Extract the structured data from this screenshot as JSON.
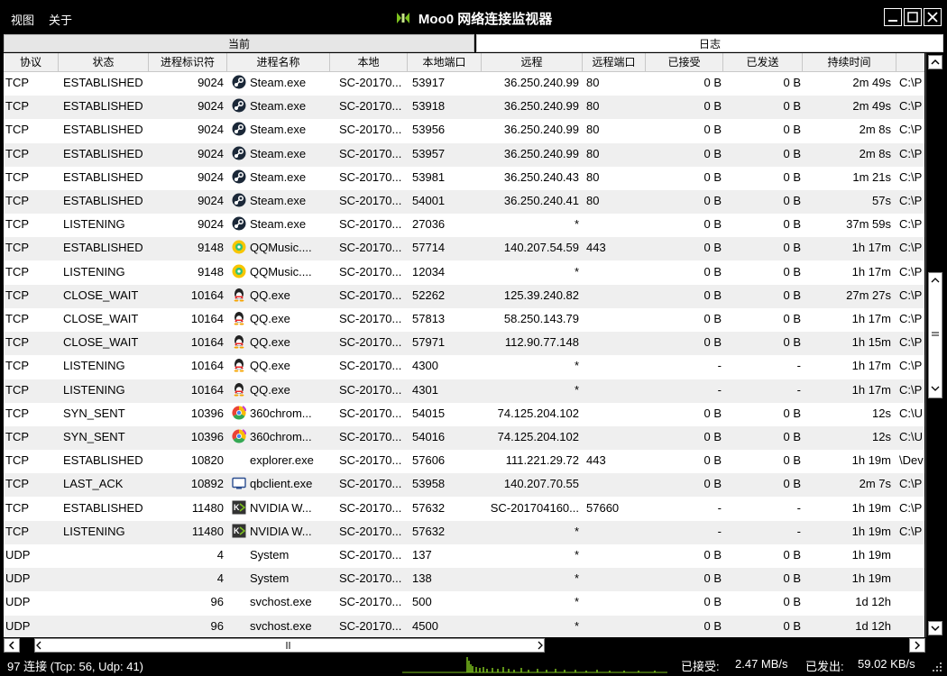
{
  "menu": {
    "view": "视图",
    "about": "关于"
  },
  "window": {
    "title": "Moo0 网络连接监视器"
  },
  "groups": {
    "current": "当前",
    "log": "日志"
  },
  "columns": {
    "protocol": "协议",
    "state": "状态",
    "pid": "进程标识符",
    "process": "进程名称",
    "local": "本地",
    "local_port": "本地端口",
    "remote": "远程",
    "remote_port": "远程端口",
    "received": "已接受",
    "sent": "已发送",
    "duration": "持续时间"
  },
  "rows": [
    {
      "protocol": "TCP",
      "state": "ESTABLISHED",
      "pid": "9024",
      "icon": "steam-icon",
      "process": "Steam.exe",
      "local": "SC-20170...",
      "local_port": "53917",
      "remote": "36.250.240.99",
      "remote_port": "80",
      "received": "0 B",
      "sent": "0 B",
      "duration": "2m 49s",
      "path": "C:\\P"
    },
    {
      "protocol": "TCP",
      "state": "ESTABLISHED",
      "pid": "9024",
      "icon": "steam-icon",
      "process": "Steam.exe",
      "local": "SC-20170...",
      "local_port": "53918",
      "remote": "36.250.240.99",
      "remote_port": "80",
      "received": "0 B",
      "sent": "0 B",
      "duration": "2m 49s",
      "path": "C:\\P"
    },
    {
      "protocol": "TCP",
      "state": "ESTABLISHED",
      "pid": "9024",
      "icon": "steam-icon",
      "process": "Steam.exe",
      "local": "SC-20170...",
      "local_port": "53956",
      "remote": "36.250.240.99",
      "remote_port": "80",
      "received": "0 B",
      "sent": "0 B",
      "duration": "2m 8s",
      "path": "C:\\P"
    },
    {
      "protocol": "TCP",
      "state": "ESTABLISHED",
      "pid": "9024",
      "icon": "steam-icon",
      "process": "Steam.exe",
      "local": "SC-20170...",
      "local_port": "53957",
      "remote": "36.250.240.99",
      "remote_port": "80",
      "received": "0 B",
      "sent": "0 B",
      "duration": "2m 8s",
      "path": "C:\\P"
    },
    {
      "protocol": "TCP",
      "state": "ESTABLISHED",
      "pid": "9024",
      "icon": "steam-icon",
      "process": "Steam.exe",
      "local": "SC-20170...",
      "local_port": "53981",
      "remote": "36.250.240.43",
      "remote_port": "80",
      "received": "0 B",
      "sent": "0 B",
      "duration": "1m 21s",
      "path": "C:\\P"
    },
    {
      "protocol": "TCP",
      "state": "ESTABLISHED",
      "pid": "9024",
      "icon": "steam-icon",
      "process": "Steam.exe",
      "local": "SC-20170...",
      "local_port": "54001",
      "remote": "36.250.240.41",
      "remote_port": "80",
      "received": "0 B",
      "sent": "0 B",
      "duration": "57s",
      "path": "C:\\P"
    },
    {
      "protocol": "TCP",
      "state": "LISTENING",
      "pid": "9024",
      "icon": "steam-icon",
      "process": "Steam.exe",
      "local": "SC-20170...",
      "local_port": "27036",
      "remote": "*",
      "remote_port": "",
      "received": "0 B",
      "sent": "0 B",
      "duration": "37m 59s",
      "path": "C:\\P"
    },
    {
      "protocol": "TCP",
      "state": "ESTABLISHED",
      "pid": "9148",
      "icon": "qqmusic-icon",
      "process": "QQMusic....",
      "local": "SC-20170...",
      "local_port": "57714",
      "remote": "140.207.54.59",
      "remote_port": "443",
      "received": "0 B",
      "sent": "0 B",
      "duration": "1h 17m",
      "path": "C:\\P"
    },
    {
      "protocol": "TCP",
      "state": "LISTENING",
      "pid": "9148",
      "icon": "qqmusic-icon",
      "process": "QQMusic....",
      "local": "SC-20170...",
      "local_port": "12034",
      "remote": "*",
      "remote_port": "",
      "received": "0 B",
      "sent": "0 B",
      "duration": "1h 17m",
      "path": "C:\\P"
    },
    {
      "protocol": "TCP",
      "state": "CLOSE_WAIT",
      "pid": "10164",
      "icon": "qq-icon",
      "process": "QQ.exe",
      "local": "SC-20170...",
      "local_port": "52262",
      "remote": "125.39.240.82",
      "remote_port": "",
      "received": "0 B",
      "sent": "0 B",
      "duration": "27m 27s",
      "path": "C:\\P"
    },
    {
      "protocol": "TCP",
      "state": "CLOSE_WAIT",
      "pid": "10164",
      "icon": "qq-icon",
      "process": "QQ.exe",
      "local": "SC-20170...",
      "local_port": "57813",
      "remote": "58.250.143.79",
      "remote_port": "",
      "received": "0 B",
      "sent": "0 B",
      "duration": "1h 17m",
      "path": "C:\\P"
    },
    {
      "protocol": "TCP",
      "state": "CLOSE_WAIT",
      "pid": "10164",
      "icon": "qq-icon",
      "process": "QQ.exe",
      "local": "SC-20170...",
      "local_port": "57971",
      "remote": "112.90.77.148",
      "remote_port": "",
      "received": "0 B",
      "sent": "0 B",
      "duration": "1h 15m",
      "path": "C:\\P"
    },
    {
      "protocol": "TCP",
      "state": "LISTENING",
      "pid": "10164",
      "icon": "qq-icon",
      "process": "QQ.exe",
      "local": "SC-20170...",
      "local_port": "4300",
      "remote": "*",
      "remote_port": "",
      "received": "-",
      "sent": "-",
      "duration": "1h 17m",
      "path": "C:\\P"
    },
    {
      "protocol": "TCP",
      "state": "LISTENING",
      "pid": "10164",
      "icon": "qq-icon",
      "process": "QQ.exe",
      "local": "SC-20170...",
      "local_port": "4301",
      "remote": "*",
      "remote_port": "",
      "received": "-",
      "sent": "-",
      "duration": "1h 17m",
      "path": "C:\\P"
    },
    {
      "protocol": "TCP",
      "state": "SYN_SENT",
      "pid": "10396",
      "icon": "360chrome-icon",
      "process": "360chrom...",
      "local": "SC-20170...",
      "local_port": "54015",
      "remote": "74.125.204.102",
      "remote_port": "",
      "received": "0 B",
      "sent": "0 B",
      "duration": "12s",
      "path": "C:\\U"
    },
    {
      "protocol": "TCP",
      "state": "SYN_SENT",
      "pid": "10396",
      "icon": "360chrome-icon",
      "process": "360chrom...",
      "local": "SC-20170...",
      "local_port": "54016",
      "remote": "74.125.204.102",
      "remote_port": "",
      "received": "0 B",
      "sent": "0 B",
      "duration": "12s",
      "path": "C:\\U"
    },
    {
      "protocol": "TCP",
      "state": "ESTABLISHED",
      "pid": "10820",
      "icon": "",
      "process": "explorer.exe",
      "local": "SC-20170...",
      "local_port": "57606",
      "remote": "111.221.29.72",
      "remote_port": "443",
      "received": "0 B",
      "sent": "0 B",
      "duration": "1h 19m",
      "path": "\\Dev"
    },
    {
      "protocol": "TCP",
      "state": "LAST_ACK",
      "pid": "10892",
      "icon": "qbclient-icon",
      "process": "qbclient.exe",
      "local": "SC-20170...",
      "local_port": "53958",
      "remote": "140.207.70.55",
      "remote_port": "",
      "received": "0 B",
      "sent": "0 B",
      "duration": "2m 7s",
      "path": "C:\\P"
    },
    {
      "protocol": "TCP",
      "state": "ESTABLISHED",
      "pid": "11480",
      "icon": "nvidia-icon",
      "process": "NVIDIA W...",
      "local": "SC-20170...",
      "local_port": "57632",
      "remote": "SC-201704160...",
      "remote_port": "57660",
      "received": "-",
      "sent": "-",
      "duration": "1h 19m",
      "path": "C:\\P"
    },
    {
      "protocol": "TCP",
      "state": "LISTENING",
      "pid": "11480",
      "icon": "nvidia-icon",
      "process": "NVIDIA W...",
      "local": "SC-20170...",
      "local_port": "57632",
      "remote": "*",
      "remote_port": "",
      "received": "-",
      "sent": "-",
      "duration": "1h 19m",
      "path": "C:\\P"
    },
    {
      "protocol": "UDP",
      "state": "",
      "pid": "4",
      "icon": "",
      "process": "System",
      "local": "SC-20170...",
      "local_port": "137",
      "remote": "*",
      "remote_port": "",
      "received": "0 B",
      "sent": "0 B",
      "duration": "1h 19m",
      "path": ""
    },
    {
      "protocol": "UDP",
      "state": "",
      "pid": "4",
      "icon": "",
      "process": "System",
      "local": "SC-20170...",
      "local_port": "138",
      "remote": "*",
      "remote_port": "",
      "received": "0 B",
      "sent": "0 B",
      "duration": "1h 19m",
      "path": ""
    },
    {
      "protocol": "UDP",
      "state": "",
      "pid": "96",
      "icon": "",
      "process": "svchost.exe",
      "local": "SC-20170...",
      "local_port": "500",
      "remote": "*",
      "remote_port": "",
      "received": "0 B",
      "sent": "0 B",
      "duration": "1d 12h",
      "path": ""
    },
    {
      "protocol": "UDP",
      "state": "",
      "pid": "96",
      "icon": "",
      "process": "svchost.exe",
      "local": "SC-20170...",
      "local_port": "4500",
      "remote": "*",
      "remote_port": "",
      "received": "0 B",
      "sent": "0 B",
      "duration": "1d 12h",
      "path": ""
    }
  ],
  "status": {
    "connections": "97 连接 (Tcp: 56, Udp: 41)",
    "received_label": "已接受:",
    "received_rate": "2.47 MB/s",
    "sent_label": "已发出:",
    "sent_rate": "59.02 KB/s"
  },
  "colors": {
    "accent_green": "#7dc21e",
    "bg": "#000000",
    "row_alt": "#efefef"
  }
}
